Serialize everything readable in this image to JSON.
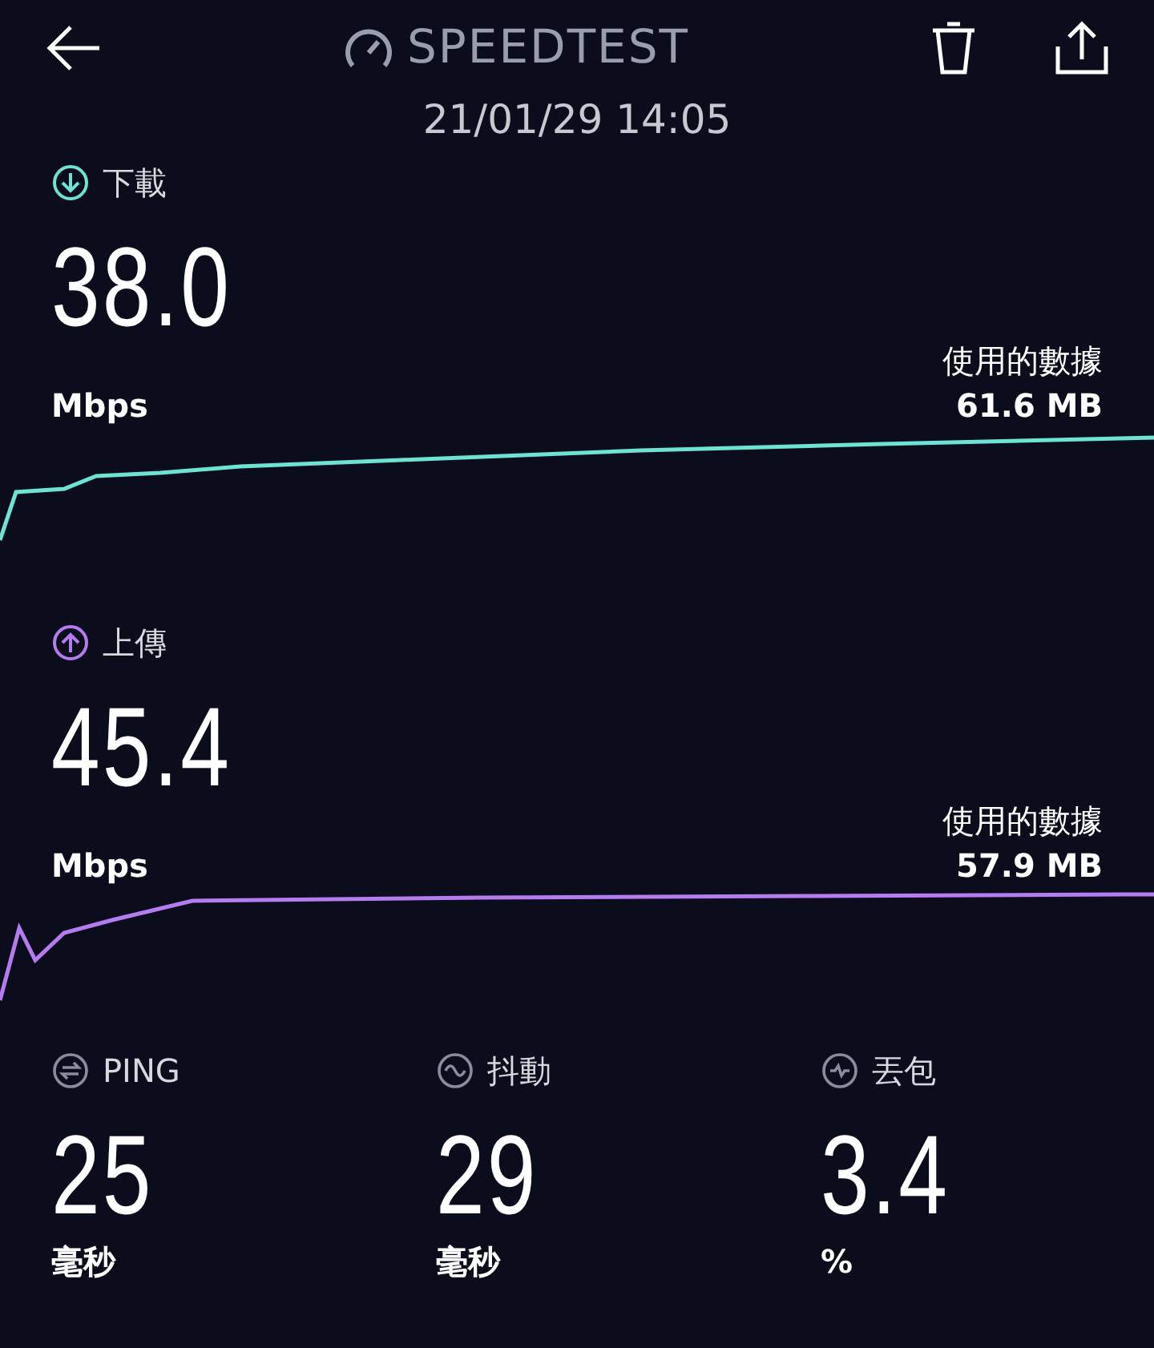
{
  "header": {
    "title": "SPEEDTEST",
    "date": "21/01/29 14:05"
  },
  "tests": [
    {
      "kind": "download",
      "label": "下載",
      "value": "38.0",
      "unit": "Mbps",
      "data_label": "使用的數據",
      "data_value": "61.6 MB",
      "color": "#6ee3d3"
    },
    {
      "kind": "upload",
      "label": "上傳",
      "value": "45.4",
      "unit": "Mbps",
      "data_label": "使用的數據",
      "data_value": "57.9 MB",
      "color": "#b57cf0"
    }
  ],
  "metrics": [
    {
      "kind": "ping",
      "label": "PING",
      "value": "25",
      "unit": "毫秒"
    },
    {
      "kind": "jitter",
      "label": "抖動",
      "value": "29",
      "unit": "毫秒"
    },
    {
      "kind": "loss",
      "label": "丟包",
      "value": "3.4",
      "unit": "%"
    }
  ]
}
